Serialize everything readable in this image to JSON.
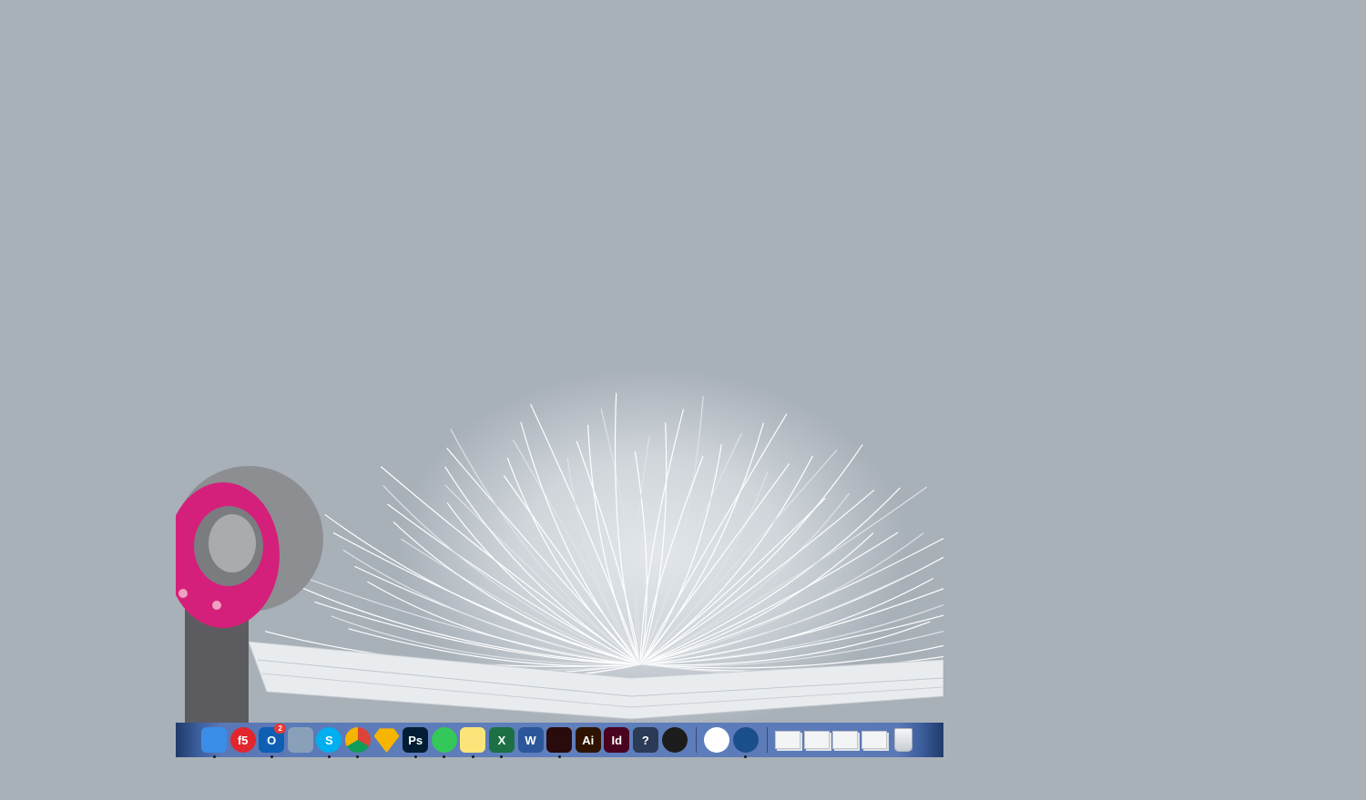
{
  "desktop": {
    "wallpaper": "open-book-pages-with-hair-dryer",
    "background_color": "#a8b0b8"
  },
  "dock": {
    "apps": [
      {
        "id": "finder",
        "icon": "finder-icon",
        "label": "",
        "color": "#3b8ee8",
        "running": true
      },
      {
        "id": "f5",
        "icon": "f5-icon",
        "label": "f5",
        "color": "#e3262e",
        "running": false
      },
      {
        "id": "outlook",
        "icon": "outlook-icon",
        "label": "O",
        "color": "#0e5fb3",
        "running": true,
        "badge": "2"
      },
      {
        "id": "archive",
        "icon": "archive-utility-icon",
        "label": "",
        "color": "#8aa0b8",
        "running": false
      },
      {
        "id": "skype",
        "icon": "skype-icon",
        "label": "S",
        "color": "#00aff0",
        "running": true
      },
      {
        "id": "chrome",
        "icon": "chrome-icon",
        "label": "",
        "color": "#ffffff",
        "running": true
      },
      {
        "id": "sketch",
        "icon": "sketch-icon",
        "label": "",
        "color": "#f7b500",
        "running": true
      },
      {
        "id": "photoshop",
        "icon": "photoshop-icon",
        "label": "Ps",
        "color": "#001d34",
        "running": true
      },
      {
        "id": "feather",
        "icon": "feather-pen-icon",
        "label": "",
        "color": "#34c759",
        "running": true
      },
      {
        "id": "notes",
        "icon": "notes-icon",
        "label": "",
        "color": "#fbe47a",
        "running": true
      },
      {
        "id": "excel",
        "icon": "excel-icon",
        "label": "X",
        "color": "#1d7044",
        "running": true
      },
      {
        "id": "word",
        "icon": "word-icon",
        "label": "W",
        "color": "#2b579a",
        "running": false
      },
      {
        "id": "acrobat",
        "icon": "acrobat-icon",
        "label": "",
        "color": "#2a0b0b",
        "running": true
      },
      {
        "id": "illustrator",
        "icon": "illustrator-icon",
        "label": "Ai",
        "color": "#2e1400",
        "running": false
      },
      {
        "id": "indesign",
        "icon": "indesign-icon",
        "label": "Id",
        "color": "#49021f",
        "running": false
      },
      {
        "id": "fish",
        "icon": "fish-help-icon",
        "label": "?",
        "color": "#2b3a55",
        "running": false
      },
      {
        "id": "instruments",
        "icon": "compass-icon",
        "label": "",
        "color": "#1c1c1c",
        "running": false
      }
    ],
    "recent": [
      {
        "id": "itunes",
        "icon": "itunes-icon",
        "label": "",
        "color": "#ffffff",
        "running": false
      },
      {
        "id": "quicktime",
        "icon": "quicktime-icon",
        "label": "",
        "color": "#1a4f8b",
        "running": true
      }
    ],
    "stacks": [
      {
        "id": "stack-1",
        "icon": "document-stack-icon"
      },
      {
        "id": "stack-2",
        "icon": "document-stack-icon"
      },
      {
        "id": "stack-3",
        "icon": "document-stack-icon"
      },
      {
        "id": "stack-4",
        "icon": "document-stack-icon"
      },
      {
        "id": "trash",
        "icon": "trash-icon"
      }
    ]
  }
}
